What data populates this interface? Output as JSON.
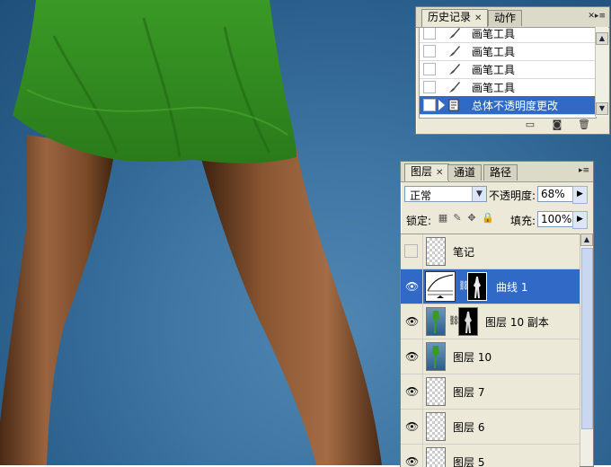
{
  "history_panel": {
    "tabs": [
      {
        "label": "历史记录",
        "active": true
      },
      {
        "label": "动作",
        "active": false
      }
    ],
    "items": [
      {
        "label": "画笔工具",
        "icon": "brush-icon",
        "selected": false
      },
      {
        "label": "画笔工具",
        "icon": "brush-icon",
        "selected": false
      },
      {
        "label": "画笔工具",
        "icon": "brush-icon",
        "selected": false
      },
      {
        "label": "画笔工具",
        "icon": "brush-icon",
        "selected": false
      },
      {
        "label": "总体不透明度更改",
        "icon": "document-icon",
        "selected": true
      }
    ],
    "footer_icons": [
      "new-document-from-state-icon",
      "new-snapshot-icon",
      "trash-icon"
    ]
  },
  "layers_panel": {
    "tabs": [
      {
        "label": "图层",
        "active": true
      },
      {
        "label": "通道",
        "active": false
      },
      {
        "label": "路径",
        "active": false
      }
    ],
    "blend_mode": "正常",
    "opacity_label": "不透明度:",
    "opacity_value": "68%",
    "lock_label": "锁定:",
    "fill_label": "填充:",
    "fill_value": "100%",
    "layers": [
      {
        "name": "笔记",
        "visible": false,
        "thumb": "checker",
        "mask": false,
        "selected": false
      },
      {
        "name": "曲线 1",
        "visible": true,
        "thumb": "curves",
        "mask": true,
        "selected": true
      },
      {
        "name": "图层 10 副本",
        "visible": true,
        "thumb": "photo",
        "mask": true,
        "selected": false
      },
      {
        "name": "图层 10",
        "visible": true,
        "thumb": "photo",
        "mask": false,
        "selected": false
      },
      {
        "name": "图层 7",
        "visible": true,
        "thumb": "checker",
        "mask": false,
        "selected": false
      },
      {
        "name": "图层 6",
        "visible": true,
        "thumb": "checker",
        "mask": false,
        "selected": false
      },
      {
        "name": "图层 5",
        "visible": true,
        "thumb": "checker",
        "mask": false,
        "selected": false
      }
    ]
  },
  "colors": {
    "selection": "#3169c6",
    "panel_bg": "#ece9d8",
    "canvas_bg": "#3f76a3",
    "skirt": "#2e8a1e"
  }
}
